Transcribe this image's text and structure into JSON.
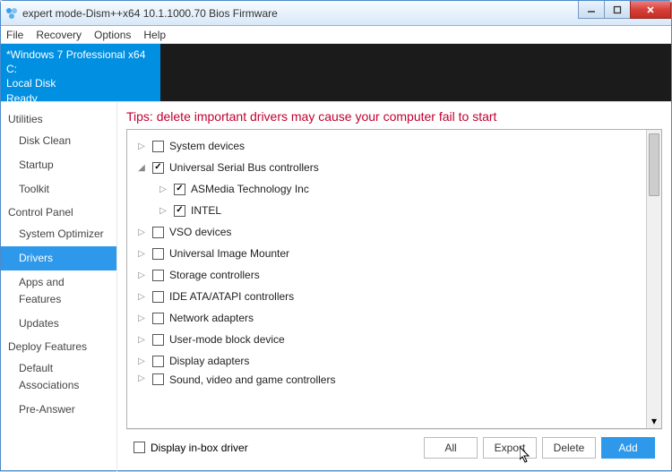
{
  "window": {
    "title": "expert mode-Dism++x64 10.1.1000.70 Bios Firmware"
  },
  "menu": {
    "file": "File",
    "recovery": "Recovery",
    "options": "Options",
    "help": "Help"
  },
  "info": {
    "line1": "*Windows 7 Professional x64",
    "line2": "C:",
    "line3": "Local Disk",
    "line4": "Ready"
  },
  "sidebar": {
    "groups": [
      {
        "head": "Utilities",
        "items": [
          "Disk Clean",
          "Startup",
          "Toolkit"
        ]
      },
      {
        "head": "Control Panel",
        "items": [
          "System Optimizer",
          "Drivers",
          "Apps and Features",
          "Updates"
        ],
        "active": "Drivers"
      },
      {
        "head": "Deploy Features",
        "items": [
          "Default Associations",
          "Pre-Answer"
        ]
      }
    ]
  },
  "main": {
    "tip": "Tips: delete important drivers may cause your computer fail to start",
    "tree": [
      {
        "depth": 1,
        "expand": "▷",
        "checked": false,
        "label": "System devices"
      },
      {
        "depth": 1,
        "expand": "◢",
        "checked": true,
        "label": "Universal Serial Bus controllers"
      },
      {
        "depth": 2,
        "expand": "▷",
        "checked": true,
        "label": "ASMedia Technology Inc"
      },
      {
        "depth": 2,
        "expand": "▷",
        "checked": true,
        "label": "INTEL"
      },
      {
        "depth": 1,
        "expand": "▷",
        "checked": false,
        "label": "VSO devices"
      },
      {
        "depth": 1,
        "expand": "▷",
        "checked": false,
        "label": "Universal Image Mounter"
      },
      {
        "depth": 1,
        "expand": "▷",
        "checked": false,
        "label": "Storage controllers"
      },
      {
        "depth": 1,
        "expand": "▷",
        "checked": false,
        "label": "IDE ATA/ATAPI controllers"
      },
      {
        "depth": 1,
        "expand": "▷",
        "checked": false,
        "label": "Network adapters"
      },
      {
        "depth": 1,
        "expand": "▷",
        "checked": false,
        "label": "User-mode block device"
      },
      {
        "depth": 1,
        "expand": "▷",
        "checked": false,
        "label": "Display adapters"
      },
      {
        "depth": 1,
        "expand": "▷",
        "checked": false,
        "label": "Sound, video and game controllers",
        "cut": true
      }
    ],
    "bottom": {
      "display_inbox": "Display in-box driver",
      "btn_all": "All",
      "btn_export": "Export",
      "btn_delete": "Delete",
      "btn_add": "Add"
    }
  }
}
